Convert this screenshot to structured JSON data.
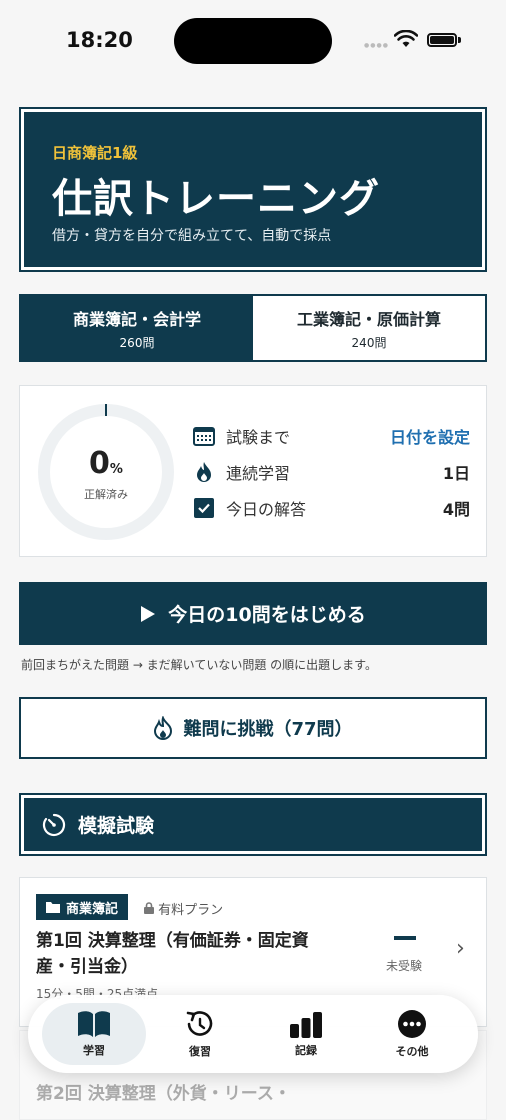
{
  "status_bar": {
    "time": "18:20"
  },
  "hero": {
    "subtitle": "日商簿記1級",
    "title": "仕訳トレーニング",
    "description": "借方・貸方を自分で組み立てて、自動で採点"
  },
  "tabs": [
    {
      "label": "商業簿記・会計学",
      "count": "260問",
      "active": true
    },
    {
      "label": "工業簿記・原価計算",
      "count": "240問",
      "active": false
    }
  ],
  "progress": {
    "percent_value": "0",
    "percent_unit": "%",
    "percent_fraction": 0,
    "caption": "正解済み"
  },
  "stats": [
    {
      "icon": "calendar-icon",
      "label": "試験まで",
      "value": "日付を設定"
    },
    {
      "icon": "flame-icon",
      "label": "連続学習",
      "value": "1日"
    },
    {
      "icon": "checkbox-icon",
      "label": "今日の解答",
      "value": "4問"
    }
  ],
  "start_button": {
    "label": "今日の10問をはじめる"
  },
  "hint": "前回まちがえた問題 → まだ解いていない問題 の順に出題します。",
  "hard_button": {
    "label": "難問に挑戦（77問）"
  },
  "mock_exam": {
    "label": "模擬試験"
  },
  "exams": [
    {
      "category": "商業簿記",
      "plan": "有料プラン",
      "title": "第1回 決算整理（有価証券・固定資産・引当金）",
      "meta": "15分・5問・25点満点",
      "score": "—",
      "status": "未受験"
    },
    {
      "title": "第2回 決算整理（外貨・リース・",
      "score": "—"
    }
  ],
  "tabbar": [
    {
      "label": "学習",
      "icon": "book-icon",
      "active": true
    },
    {
      "label": "復習",
      "icon": "review-icon",
      "active": false
    },
    {
      "label": "記録",
      "icon": "bar-chart-icon",
      "active": false
    },
    {
      "label": "その他",
      "icon": "more-icon",
      "active": false
    }
  ],
  "colors": {
    "primary": "#0f3a4d",
    "accent": "#f0c23a",
    "link": "#1f6fb0"
  }
}
